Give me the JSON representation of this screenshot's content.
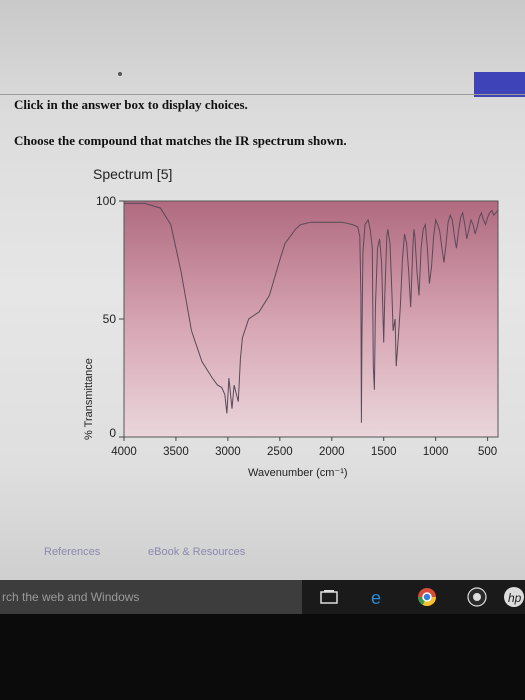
{
  "instructions": {
    "line1": "Click in the answer box to display choices.",
    "line2": "Choose the compound that matches the IR spectrum shown."
  },
  "spectrum_title": "Spectrum [5]",
  "links": {
    "references": "References",
    "ebook": "eBook & Resources"
  },
  "taskbar": {
    "search_placeholder": "rch the web and Windows"
  },
  "colors": {
    "plot_top": "#b06a80",
    "plot_bottom": "#ead6dc",
    "accent": "#3f43b8"
  },
  "chart_data": {
    "type": "line",
    "title": "Spectrum [5]",
    "xlabel": "Wavenumber (cm⁻¹)",
    "ylabel": "% Transmittance",
    "xlim": [
      4000,
      400
    ],
    "ylim": [
      0,
      100
    ],
    "x_ticks": [
      "4000",
      "3500",
      "3000",
      "2500",
      "2000",
      "1500",
      "1000",
      "500"
    ],
    "y_ticks": [
      "0",
      "50",
      "100"
    ],
    "series": [
      {
        "x": [
          4000,
          3800,
          3650,
          3550,
          3450,
          3350,
          3250,
          3150,
          3100,
          3060,
          3030,
          3010,
          2990,
          2960,
          2940,
          2900,
          2880,
          2860,
          2800,
          2700,
          2600,
          2500,
          2450,
          2400,
          2350,
          2300,
          2200,
          2100,
          2000,
          1900,
          1800,
          1750,
          1730,
          1720,
          1715,
          1710,
          1700,
          1680,
          1650,
          1630,
          1610,
          1600,
          1590,
          1580,
          1560,
          1540,
          1520,
          1500,
          1490,
          1470,
          1460,
          1440,
          1420,
          1410,
          1390,
          1380,
          1360,
          1340,
          1320,
          1300,
          1280,
          1260,
          1240,
          1220,
          1210,
          1200,
          1180,
          1160,
          1140,
          1120,
          1100,
          1080,
          1060,
          1040,
          1020,
          1000,
          980,
          960,
          940,
          920,
          900,
          880,
          860,
          840,
          820,
          800,
          780,
          760,
          740,
          720,
          700,
          680,
          660,
          640,
          620,
          600,
          580,
          560,
          540,
          520,
          500,
          480,
          460,
          440,
          420,
          400
        ],
        "y": [
          99,
          99,
          97,
          90,
          70,
          45,
          32,
          25,
          22,
          21,
          18,
          10,
          25,
          12,
          22,
          15,
          33,
          42,
          50,
          53,
          60,
          75,
          82,
          85,
          88,
          90,
          91,
          91,
          91,
          91,
          90,
          89,
          85,
          60,
          6,
          40,
          78,
          90,
          92,
          88,
          80,
          30,
          20,
          55,
          80,
          84,
          74,
          40,
          60,
          85,
          88,
          82,
          60,
          45,
          50,
          30,
          42,
          55,
          75,
          86,
          82,
          70,
          55,
          80,
          88,
          85,
          70,
          60,
          80,
          88,
          90,
          80,
          65,
          72,
          85,
          92,
          90,
          87,
          80,
          74,
          82,
          91,
          94,
          92,
          85,
          80,
          87,
          93,
          95,
          90,
          84,
          88,
          92,
          90,
          86,
          89,
          93,
          95,
          92,
          90,
          93,
          95,
          96,
          94,
          95,
          96
        ]
      }
    ]
  }
}
